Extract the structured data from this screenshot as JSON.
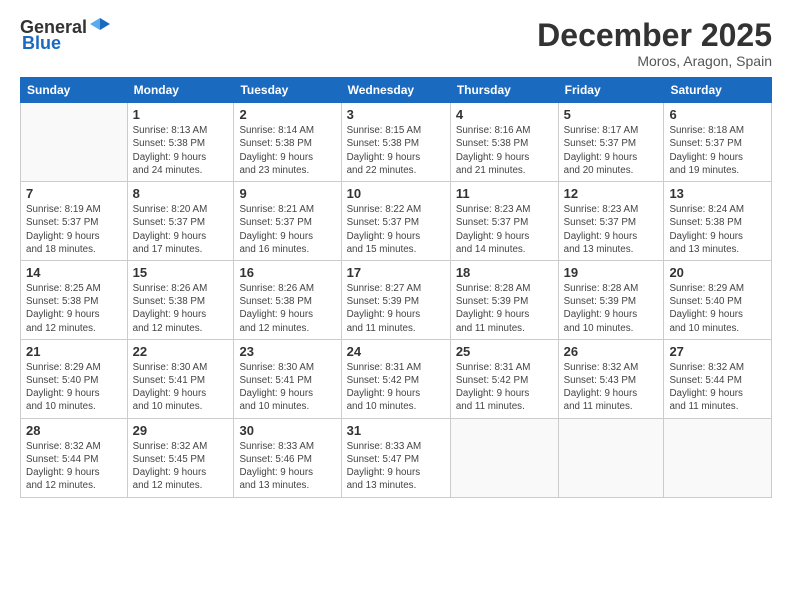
{
  "logo": {
    "general": "General",
    "blue": "Blue"
  },
  "title": "December 2025",
  "location": "Moros, Aragon, Spain",
  "days_header": [
    "Sunday",
    "Monday",
    "Tuesday",
    "Wednesday",
    "Thursday",
    "Friday",
    "Saturday"
  ],
  "weeks": [
    [
      {
        "day": "",
        "info": ""
      },
      {
        "day": "1",
        "info": "Sunrise: 8:13 AM\nSunset: 5:38 PM\nDaylight: 9 hours\nand 24 minutes."
      },
      {
        "day": "2",
        "info": "Sunrise: 8:14 AM\nSunset: 5:38 PM\nDaylight: 9 hours\nand 23 minutes."
      },
      {
        "day": "3",
        "info": "Sunrise: 8:15 AM\nSunset: 5:38 PM\nDaylight: 9 hours\nand 22 minutes."
      },
      {
        "day": "4",
        "info": "Sunrise: 8:16 AM\nSunset: 5:38 PM\nDaylight: 9 hours\nand 21 minutes."
      },
      {
        "day": "5",
        "info": "Sunrise: 8:17 AM\nSunset: 5:37 PM\nDaylight: 9 hours\nand 20 minutes."
      },
      {
        "day": "6",
        "info": "Sunrise: 8:18 AM\nSunset: 5:37 PM\nDaylight: 9 hours\nand 19 minutes."
      }
    ],
    [
      {
        "day": "7",
        "info": "Sunrise: 8:19 AM\nSunset: 5:37 PM\nDaylight: 9 hours\nand 18 minutes."
      },
      {
        "day": "8",
        "info": "Sunrise: 8:20 AM\nSunset: 5:37 PM\nDaylight: 9 hours\nand 17 minutes."
      },
      {
        "day": "9",
        "info": "Sunrise: 8:21 AM\nSunset: 5:37 PM\nDaylight: 9 hours\nand 16 minutes."
      },
      {
        "day": "10",
        "info": "Sunrise: 8:22 AM\nSunset: 5:37 PM\nDaylight: 9 hours\nand 15 minutes."
      },
      {
        "day": "11",
        "info": "Sunrise: 8:23 AM\nSunset: 5:37 PM\nDaylight: 9 hours\nand 14 minutes."
      },
      {
        "day": "12",
        "info": "Sunrise: 8:23 AM\nSunset: 5:37 PM\nDaylight: 9 hours\nand 13 minutes."
      },
      {
        "day": "13",
        "info": "Sunrise: 8:24 AM\nSunset: 5:38 PM\nDaylight: 9 hours\nand 13 minutes."
      }
    ],
    [
      {
        "day": "14",
        "info": "Sunrise: 8:25 AM\nSunset: 5:38 PM\nDaylight: 9 hours\nand 12 minutes."
      },
      {
        "day": "15",
        "info": "Sunrise: 8:26 AM\nSunset: 5:38 PM\nDaylight: 9 hours\nand 12 minutes."
      },
      {
        "day": "16",
        "info": "Sunrise: 8:26 AM\nSunset: 5:38 PM\nDaylight: 9 hours\nand 12 minutes."
      },
      {
        "day": "17",
        "info": "Sunrise: 8:27 AM\nSunset: 5:39 PM\nDaylight: 9 hours\nand 11 minutes."
      },
      {
        "day": "18",
        "info": "Sunrise: 8:28 AM\nSunset: 5:39 PM\nDaylight: 9 hours\nand 11 minutes."
      },
      {
        "day": "19",
        "info": "Sunrise: 8:28 AM\nSunset: 5:39 PM\nDaylight: 9 hours\nand 10 minutes."
      },
      {
        "day": "20",
        "info": "Sunrise: 8:29 AM\nSunset: 5:40 PM\nDaylight: 9 hours\nand 10 minutes."
      }
    ],
    [
      {
        "day": "21",
        "info": "Sunrise: 8:29 AM\nSunset: 5:40 PM\nDaylight: 9 hours\nand 10 minutes."
      },
      {
        "day": "22",
        "info": "Sunrise: 8:30 AM\nSunset: 5:41 PM\nDaylight: 9 hours\nand 10 minutes."
      },
      {
        "day": "23",
        "info": "Sunrise: 8:30 AM\nSunset: 5:41 PM\nDaylight: 9 hours\nand 10 minutes."
      },
      {
        "day": "24",
        "info": "Sunrise: 8:31 AM\nSunset: 5:42 PM\nDaylight: 9 hours\nand 10 minutes."
      },
      {
        "day": "25",
        "info": "Sunrise: 8:31 AM\nSunset: 5:42 PM\nDaylight: 9 hours\nand 11 minutes."
      },
      {
        "day": "26",
        "info": "Sunrise: 8:32 AM\nSunset: 5:43 PM\nDaylight: 9 hours\nand 11 minutes."
      },
      {
        "day": "27",
        "info": "Sunrise: 8:32 AM\nSunset: 5:44 PM\nDaylight: 9 hours\nand 11 minutes."
      }
    ],
    [
      {
        "day": "28",
        "info": "Sunrise: 8:32 AM\nSunset: 5:44 PM\nDaylight: 9 hours\nand 12 minutes."
      },
      {
        "day": "29",
        "info": "Sunrise: 8:32 AM\nSunset: 5:45 PM\nDaylight: 9 hours\nand 12 minutes."
      },
      {
        "day": "30",
        "info": "Sunrise: 8:33 AM\nSunset: 5:46 PM\nDaylight: 9 hours\nand 13 minutes."
      },
      {
        "day": "31",
        "info": "Sunrise: 8:33 AM\nSunset: 5:47 PM\nDaylight: 9 hours\nand 13 minutes."
      },
      {
        "day": "",
        "info": ""
      },
      {
        "day": "",
        "info": ""
      },
      {
        "day": "",
        "info": ""
      }
    ]
  ]
}
